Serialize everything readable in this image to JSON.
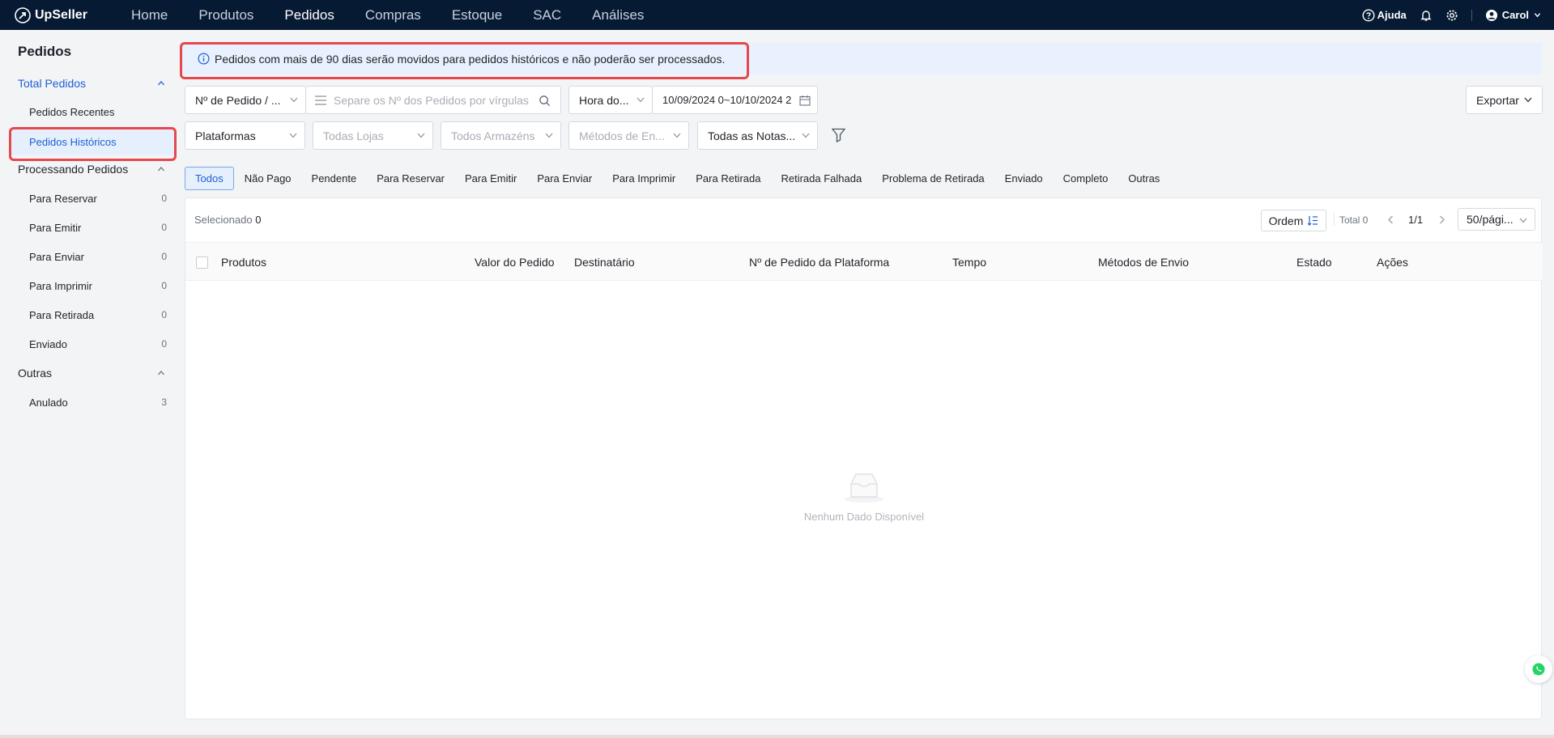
{
  "brand": {
    "name": "UpSeller"
  },
  "nav": {
    "items": [
      {
        "label": "Home"
      },
      {
        "label": "Produtos"
      },
      {
        "label": "Pedidos",
        "active": true
      },
      {
        "label": "Compras"
      },
      {
        "label": "Estoque"
      },
      {
        "label": "SAC"
      },
      {
        "label": "Análises"
      }
    ]
  },
  "topbar": {
    "help_label": "Ajuda",
    "user_name": "Carol"
  },
  "sidebar": {
    "title": "Pedidos",
    "total_group": "Total Pedidos",
    "recent": "Pedidos Recentes",
    "historic": "Pedidos Históricos",
    "processing_group": "Processando Pedidos",
    "processing_items": [
      {
        "label": "Para Reservar",
        "count": "0"
      },
      {
        "label": "Para Emitir",
        "count": "0"
      },
      {
        "label": "Para Enviar",
        "count": "0"
      },
      {
        "label": "Para Imprimir",
        "count": "0"
      },
      {
        "label": "Para Retirada",
        "count": "0"
      },
      {
        "label": "Enviado",
        "count": "0"
      }
    ],
    "other_group": "Outras",
    "other_items": [
      {
        "label": "Anulado",
        "count": "3"
      }
    ]
  },
  "notice": {
    "text": "Pedidos com mais de 90 dias serão movidos para pedidos históricos e não poderão ser processados."
  },
  "filters": {
    "order_type": "Nº de Pedido / ...",
    "order_search_placeholder": "Separe os Nº dos Pedidos por vírgulas",
    "time_type": "Hora do...",
    "date_range": "10/09/2024 0~10/10/2024 2",
    "export_label": "Exportar",
    "platforms": "Plataformas",
    "stores_placeholder": "Todas Lojas",
    "warehouses_placeholder": "Todos Armazéns",
    "shipping_placeholder": "Métodos de En...",
    "invoices": "Todas as Notas..."
  },
  "tabs": [
    {
      "label": "Todos",
      "active": true
    },
    {
      "label": "Não Pago"
    },
    {
      "label": "Pendente"
    },
    {
      "label": "Para Reservar"
    },
    {
      "label": "Para Emitir"
    },
    {
      "label": "Para Enviar"
    },
    {
      "label": "Para Imprimir"
    },
    {
      "label": "Para Retirada"
    },
    {
      "label": "Retirada Falhada"
    },
    {
      "label": "Problema de Retirada"
    },
    {
      "label": "Enviado"
    },
    {
      "label": "Completo"
    },
    {
      "label": "Outras"
    }
  ],
  "table": {
    "selected_label": "Selecionado",
    "selected_count": "0",
    "order_label": "Ordem",
    "total_label": "Total 0",
    "page_label": "1/1",
    "page_size": "50/pági...",
    "columns": [
      "Produtos",
      "Valor do Pedido",
      "Destinatário",
      "Nº de Pedido da Plataforma",
      "Tempo",
      "Métodos de Envio",
      "Estado",
      "Ações"
    ],
    "empty_text": "Nenhum Dado Disponível"
  },
  "colors": {
    "accent": "#1d5fd6",
    "topbar": "#061a33",
    "highlight": "#e5484d",
    "whatsapp": "#25d366"
  }
}
